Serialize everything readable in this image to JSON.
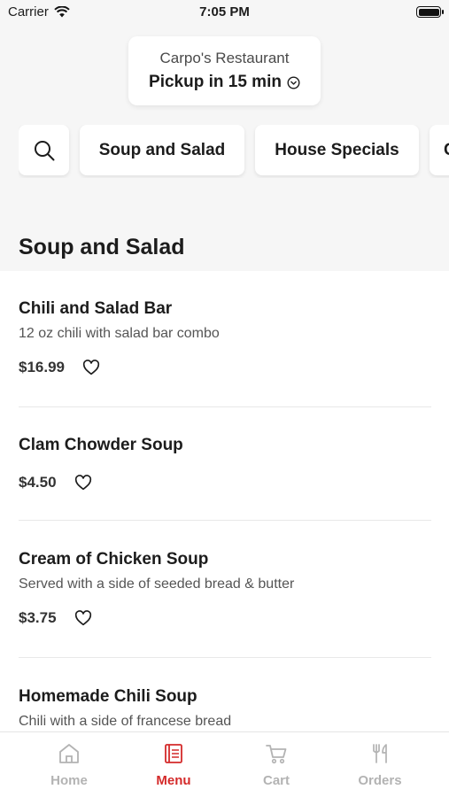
{
  "status_bar": {
    "carrier": "Carrier",
    "time": "7:05 PM"
  },
  "store": {
    "name": "Carpo's Restaurant",
    "pickup": "Pickup in 15 min"
  },
  "categories": [
    {
      "label": "Soup and Salad"
    },
    {
      "label": "House Specials"
    },
    {
      "label": "C"
    }
  ],
  "section": {
    "title": "Soup and Salad"
  },
  "items": [
    {
      "name": "Chili and Salad Bar",
      "description": "12 oz chili with salad bar combo",
      "price": "$16.99"
    },
    {
      "name": "Clam Chowder Soup",
      "description": "",
      "price": "$4.50"
    },
    {
      "name": "Cream of Chicken Soup",
      "description": "Served with a side of seeded bread & butter",
      "price": "$3.75"
    },
    {
      "name": "Homemade Chili Soup",
      "description": "Chili with a side of francese bread",
      "price": ""
    }
  ],
  "tabs": [
    {
      "label": "Home",
      "icon": "home-icon"
    },
    {
      "label": "Menu",
      "icon": "menu-icon",
      "active": true
    },
    {
      "label": "Cart",
      "icon": "cart-icon"
    },
    {
      "label": "Orders",
      "icon": "orders-icon"
    }
  ],
  "colors": {
    "accent": "#d42a2a",
    "inactive_tab": "#b3b3b3",
    "background": "#f6f6f6"
  }
}
